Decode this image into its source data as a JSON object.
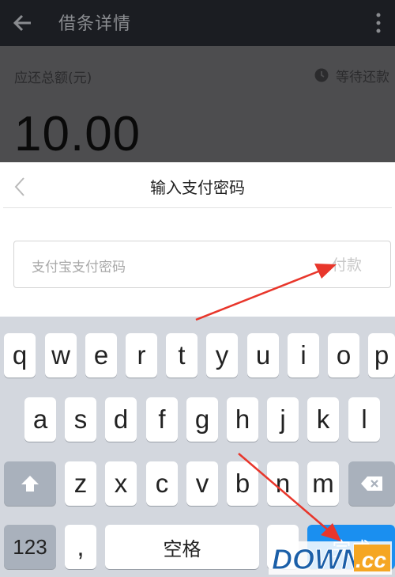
{
  "appbar": {
    "title": "借条详情",
    "back_icon": "arrow-left-icon",
    "more_icon": "overflow-menu-icon"
  },
  "loan": {
    "label": "应还总额(元)",
    "amount": "10.00",
    "status": "等待还款",
    "status_icon": "clock-icon"
  },
  "dialog": {
    "title": "输入支付密码",
    "back_icon": "chevron-left-icon",
    "password_placeholder": "支付宝支付密码",
    "pay_button": "付款"
  },
  "keyboard": {
    "row1": [
      "q",
      "w",
      "e",
      "r",
      "t",
      "y",
      "u",
      "i",
      "o",
      "p"
    ],
    "row2": [
      "a",
      "s",
      "d",
      "f",
      "g",
      "h",
      "j",
      "k",
      "l"
    ],
    "row3": [
      "z",
      "x",
      "c",
      "v",
      "b",
      "n",
      "m"
    ],
    "num_key": "123",
    "comma_key": ",",
    "space_key": "空格",
    "done_key": "完成",
    "shift_icon": "shift-arrow-icon",
    "backspace_icon": "backspace-icon"
  },
  "watermark": {
    "text1": "DOWN",
    "text2": ".cc"
  },
  "colors": {
    "accent": "#1a8ff0",
    "arrow": "#e8362b",
    "dim_overlay": "#4d4d4f"
  }
}
